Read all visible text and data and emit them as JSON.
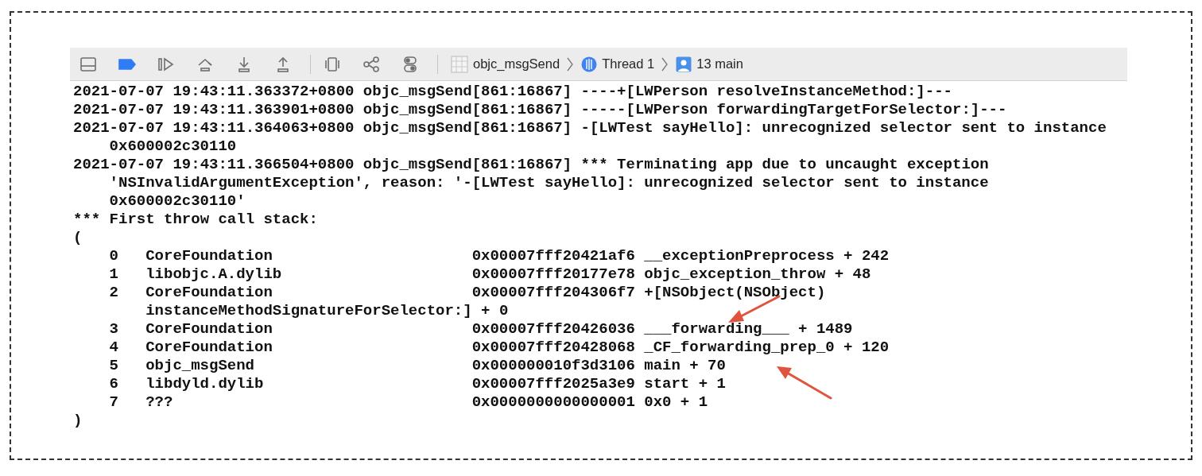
{
  "toolbar": {
    "breakpoints_active": true,
    "jump_bar": [
      {
        "kind": "app",
        "label": "objc_msgSend"
      },
      {
        "kind": "thread",
        "label": "Thread 1"
      },
      {
        "kind": "frame",
        "label": "13 main"
      }
    ]
  },
  "console": {
    "messages": [
      {
        "lines": [
          "2021-07-07 19:43:11.363372+0800 objc_msgSend[861:16867] ----+[LWPerson resolveInstanceMethod:]---"
        ]
      },
      {
        "lines": [
          "2021-07-07 19:43:11.363901+0800 objc_msgSend[861:16867] -----[LWPerson forwardingTargetForSelector:]---"
        ]
      },
      {
        "lines": [
          "2021-07-07 19:43:11.364063+0800 objc_msgSend[861:16867] -[LWTest sayHello]: unrecognized selector sent to instance",
          "0x600002c30110"
        ]
      },
      {
        "lines": [
          "2021-07-07 19:43:11.366504+0800 objc_msgSend[861:16867] *** Terminating app due to uncaught exception",
          "'NSInvalidArgumentException', reason: '-[LWTest sayHello]: unrecognized selector sent to instance",
          "0x600002c30110'"
        ]
      },
      {
        "lines": [
          "*** First throw call stack:"
        ]
      },
      {
        "lines": [
          "("
        ]
      }
    ],
    "frames": [
      {
        "index": "0",
        "library": "CoreFoundation",
        "address": "0x00007fff20421af6",
        "symbol": "__exceptionPreprocess + 242"
      },
      {
        "index": "1",
        "library": "libobjc.A.dylib",
        "address": "0x00007fff20177e78",
        "symbol": "objc_exception_throw + 48"
      },
      {
        "index": "2",
        "library": "CoreFoundation",
        "address": "0x00007fff204306f7",
        "symbol": "+[NSObject(NSObject)",
        "symbol_continued": "instanceMethodSignatureForSelector:] + 0"
      },
      {
        "index": "3",
        "library": "CoreFoundation",
        "address": "0x00007fff20426036",
        "symbol": "___forwarding___ + 1489"
      },
      {
        "index": "4",
        "library": "CoreFoundation",
        "address": "0x00007fff20428068",
        "symbol": "_CF_forwarding_prep_0 + 120"
      },
      {
        "index": "5",
        "library": "objc_msgSend",
        "address": "0x000000010f3d3106",
        "symbol": "main + 70"
      },
      {
        "index": "6",
        "library": "libdyld.dylib",
        "address": "0x00007fff2025a3e9",
        "symbol": "start + 1"
      },
      {
        "index": "7",
        "library": "???",
        "address": "0x0000000000000001",
        "symbol": "0x0 + 1"
      }
    ],
    "closing": ")"
  }
}
